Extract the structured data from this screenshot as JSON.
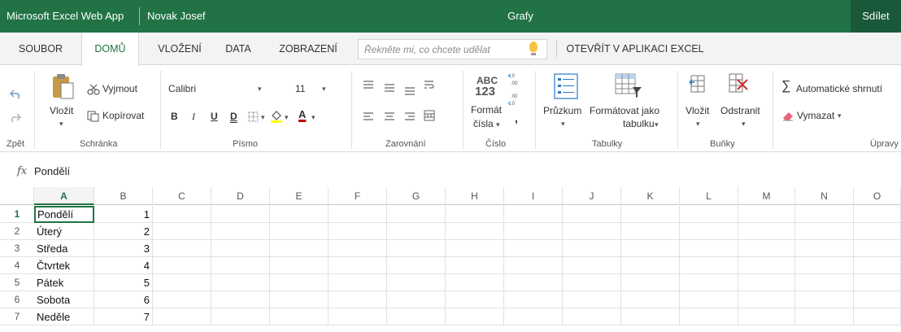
{
  "titlebar": {
    "app_name": "Microsoft Excel Web App",
    "user_name": "Novak Josef",
    "document_title": "Grafy",
    "share_label": "Sdílet"
  },
  "tabs": [
    {
      "label": "SOUBOR",
      "active": false
    },
    {
      "label": "DOMŮ",
      "active": true
    },
    {
      "label": "VLOŽENÍ",
      "active": false
    },
    {
      "label": "DATA",
      "active": false
    },
    {
      "label": "ZOBRAZENÍ",
      "active": false
    }
  ],
  "tell_me": {
    "placeholder": "Řekněte mi, co chcete udělat"
  },
  "open_in_excel_label": "OTEVŘÍT V APLIKACI EXCEL",
  "ribbon": {
    "undo_group_label": "Zpět",
    "clipboard": {
      "group_label": "Schránka",
      "paste_label": "Vložit",
      "cut_label": "Vyjmout",
      "copy_label": "Kopírovat"
    },
    "font": {
      "group_label": "Písmo",
      "font_name": "Calibri",
      "font_size": "11",
      "bold": "B",
      "italic": "I",
      "underline": "U",
      "double_underline": "D",
      "font_color_letter": "A"
    },
    "alignment": {
      "group_label": "Zarovnání"
    },
    "number": {
      "group_label": "Číslo",
      "format_label_line1": "Formát",
      "format_label_line2": "čísla",
      "abc": "ABC",
      "n123": "123",
      "comma": ","
    },
    "tables": {
      "group_label": "Tabulky",
      "survey_label": "Průzkum",
      "format_table_line1": "Formátovat jako",
      "format_table_line2": "tabulku"
    },
    "cells": {
      "group_label": "Buňky",
      "insert_label": "Vložit",
      "delete_label": "Odstranit"
    },
    "editing": {
      "group_label": "Úpravy",
      "autosum_label": "Automatické shrnutí",
      "clear_label": "Vymazat"
    }
  },
  "formula_bar": {
    "fx": "fx",
    "value": "Pondělí"
  },
  "columns": [
    "A",
    "B",
    "C",
    "D",
    "E",
    "F",
    "G",
    "H",
    "I",
    "J",
    "K",
    "L",
    "M",
    "N",
    "O"
  ],
  "rows": [
    {
      "n": "1",
      "a": "Pondělí",
      "b": "1"
    },
    {
      "n": "2",
      "a": "Úterý",
      "b": "2"
    },
    {
      "n": "3",
      "a": "Středa",
      "b": "3"
    },
    {
      "n": "4",
      "a": "Čtvrtek",
      "b": "4"
    },
    {
      "n": "5",
      "a": "Pátek",
      "b": "5"
    },
    {
      "n": "6",
      "a": "Sobota",
      "b": "6"
    },
    {
      "n": "7",
      "a": "Neděle",
      "b": "7"
    }
  ],
  "colors": {
    "brand": "#217346",
    "share_bg": "#19593a"
  }
}
